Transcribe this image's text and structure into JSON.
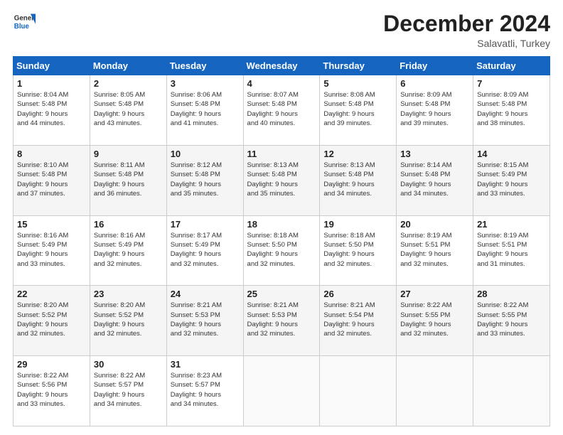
{
  "header": {
    "logo_general": "General",
    "logo_blue": "Blue",
    "month_year": "December 2024",
    "location": "Salavatli, Turkey"
  },
  "days_of_week": [
    "Sunday",
    "Monday",
    "Tuesday",
    "Wednesday",
    "Thursday",
    "Friday",
    "Saturday"
  ],
  "weeks": [
    [
      {
        "day": 1,
        "lines": [
          "Sunrise: 8:04 AM",
          "Sunset: 5:48 PM",
          "Daylight: 9 hours",
          "and 44 minutes."
        ]
      },
      {
        "day": 2,
        "lines": [
          "Sunrise: 8:05 AM",
          "Sunset: 5:48 PM",
          "Daylight: 9 hours",
          "and 43 minutes."
        ]
      },
      {
        "day": 3,
        "lines": [
          "Sunrise: 8:06 AM",
          "Sunset: 5:48 PM",
          "Daylight: 9 hours",
          "and 41 minutes."
        ]
      },
      {
        "day": 4,
        "lines": [
          "Sunrise: 8:07 AM",
          "Sunset: 5:48 PM",
          "Daylight: 9 hours",
          "and 40 minutes."
        ]
      },
      {
        "day": 5,
        "lines": [
          "Sunrise: 8:08 AM",
          "Sunset: 5:48 PM",
          "Daylight: 9 hours",
          "and 39 minutes."
        ]
      },
      {
        "day": 6,
        "lines": [
          "Sunrise: 8:09 AM",
          "Sunset: 5:48 PM",
          "Daylight: 9 hours",
          "and 39 minutes."
        ]
      },
      {
        "day": 7,
        "lines": [
          "Sunrise: 8:09 AM",
          "Sunset: 5:48 PM",
          "Daylight: 9 hours",
          "and 38 minutes."
        ]
      }
    ],
    [
      {
        "day": 8,
        "lines": [
          "Sunrise: 8:10 AM",
          "Sunset: 5:48 PM",
          "Daylight: 9 hours",
          "and 37 minutes."
        ]
      },
      {
        "day": 9,
        "lines": [
          "Sunrise: 8:11 AM",
          "Sunset: 5:48 PM",
          "Daylight: 9 hours",
          "and 36 minutes."
        ]
      },
      {
        "day": 10,
        "lines": [
          "Sunrise: 8:12 AM",
          "Sunset: 5:48 PM",
          "Daylight: 9 hours",
          "and 35 minutes."
        ]
      },
      {
        "day": 11,
        "lines": [
          "Sunrise: 8:13 AM",
          "Sunset: 5:48 PM",
          "Daylight: 9 hours",
          "and 35 minutes."
        ]
      },
      {
        "day": 12,
        "lines": [
          "Sunrise: 8:13 AM",
          "Sunset: 5:48 PM",
          "Daylight: 9 hours",
          "and 34 minutes."
        ]
      },
      {
        "day": 13,
        "lines": [
          "Sunrise: 8:14 AM",
          "Sunset: 5:48 PM",
          "Daylight: 9 hours",
          "and 34 minutes."
        ]
      },
      {
        "day": 14,
        "lines": [
          "Sunrise: 8:15 AM",
          "Sunset: 5:49 PM",
          "Daylight: 9 hours",
          "and 33 minutes."
        ]
      }
    ],
    [
      {
        "day": 15,
        "lines": [
          "Sunrise: 8:16 AM",
          "Sunset: 5:49 PM",
          "Daylight: 9 hours",
          "and 33 minutes."
        ]
      },
      {
        "day": 16,
        "lines": [
          "Sunrise: 8:16 AM",
          "Sunset: 5:49 PM",
          "Daylight: 9 hours",
          "and 32 minutes."
        ]
      },
      {
        "day": 17,
        "lines": [
          "Sunrise: 8:17 AM",
          "Sunset: 5:49 PM",
          "Daylight: 9 hours",
          "and 32 minutes."
        ]
      },
      {
        "day": 18,
        "lines": [
          "Sunrise: 8:18 AM",
          "Sunset: 5:50 PM",
          "Daylight: 9 hours",
          "and 32 minutes."
        ]
      },
      {
        "day": 19,
        "lines": [
          "Sunrise: 8:18 AM",
          "Sunset: 5:50 PM",
          "Daylight: 9 hours",
          "and 32 minutes."
        ]
      },
      {
        "day": 20,
        "lines": [
          "Sunrise: 8:19 AM",
          "Sunset: 5:51 PM",
          "Daylight: 9 hours",
          "and 32 minutes."
        ]
      },
      {
        "day": 21,
        "lines": [
          "Sunrise: 8:19 AM",
          "Sunset: 5:51 PM",
          "Daylight: 9 hours",
          "and 31 minutes."
        ]
      }
    ],
    [
      {
        "day": 22,
        "lines": [
          "Sunrise: 8:20 AM",
          "Sunset: 5:52 PM",
          "Daylight: 9 hours",
          "and 32 minutes."
        ]
      },
      {
        "day": 23,
        "lines": [
          "Sunrise: 8:20 AM",
          "Sunset: 5:52 PM",
          "Daylight: 9 hours",
          "and 32 minutes."
        ]
      },
      {
        "day": 24,
        "lines": [
          "Sunrise: 8:21 AM",
          "Sunset: 5:53 PM",
          "Daylight: 9 hours",
          "and 32 minutes."
        ]
      },
      {
        "day": 25,
        "lines": [
          "Sunrise: 8:21 AM",
          "Sunset: 5:53 PM",
          "Daylight: 9 hours",
          "and 32 minutes."
        ]
      },
      {
        "day": 26,
        "lines": [
          "Sunrise: 8:21 AM",
          "Sunset: 5:54 PM",
          "Daylight: 9 hours",
          "and 32 minutes."
        ]
      },
      {
        "day": 27,
        "lines": [
          "Sunrise: 8:22 AM",
          "Sunset: 5:55 PM",
          "Daylight: 9 hours",
          "and 32 minutes."
        ]
      },
      {
        "day": 28,
        "lines": [
          "Sunrise: 8:22 AM",
          "Sunset: 5:55 PM",
          "Daylight: 9 hours",
          "and 33 minutes."
        ]
      }
    ],
    [
      {
        "day": 29,
        "lines": [
          "Sunrise: 8:22 AM",
          "Sunset: 5:56 PM",
          "Daylight: 9 hours",
          "and 33 minutes."
        ]
      },
      {
        "day": 30,
        "lines": [
          "Sunrise: 8:22 AM",
          "Sunset: 5:57 PM",
          "Daylight: 9 hours",
          "and 34 minutes."
        ]
      },
      {
        "day": 31,
        "lines": [
          "Sunrise: 8:23 AM",
          "Sunset: 5:57 PM",
          "Daylight: 9 hours",
          "and 34 minutes."
        ]
      },
      null,
      null,
      null,
      null
    ]
  ]
}
